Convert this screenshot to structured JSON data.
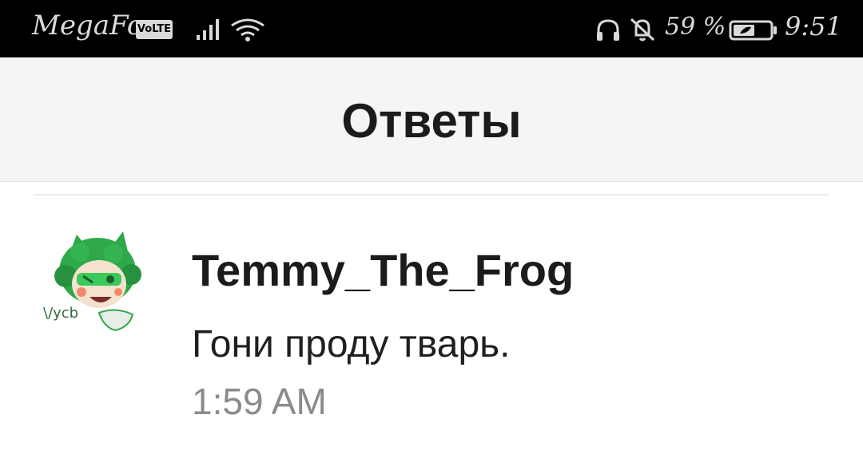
{
  "status_bar": {
    "carrier": "MegaFon",
    "volte": "VoLTE",
    "battery_percent": "59 %",
    "time": "9:51",
    "icons": [
      "signal-icon",
      "wifi-icon",
      "headphone-icon",
      "bell-off-icon",
      "battery-icon"
    ]
  },
  "header": {
    "title": "Ответы"
  },
  "replies": [
    {
      "username": "Temmy_The_Frog",
      "message": "Гони проду тварь.",
      "time": "1:59 AM",
      "avatar_icon": "green-character-avatar"
    }
  ],
  "colors": {
    "status_bar_bg": "#000000",
    "header_bg": "#f5f4f6",
    "title": "#1b1b1b",
    "timestamp": "#8b8b8b",
    "avatar_green": "#2fa84a"
  }
}
